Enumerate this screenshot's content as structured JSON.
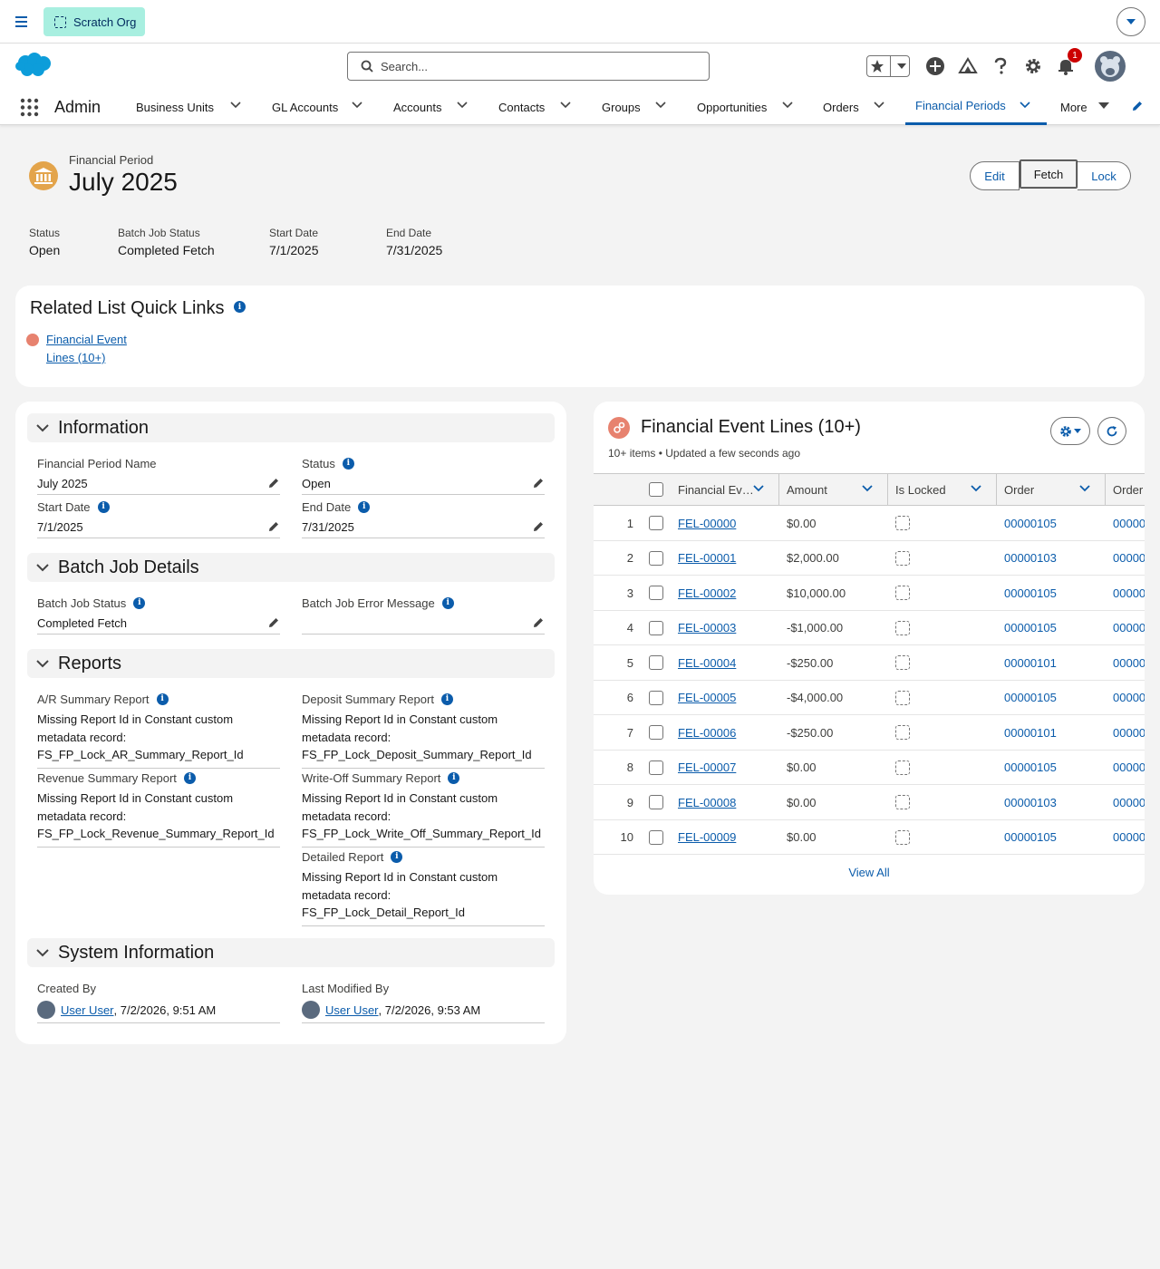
{
  "topbar": {
    "org_label": "Scratch Org"
  },
  "header": {
    "search_placeholder": "Search...",
    "notification_count": "1"
  },
  "nav": {
    "app_name": "Admin",
    "items": [
      {
        "label": "Business Units"
      },
      {
        "label": "GL Accounts"
      },
      {
        "label": "Accounts"
      },
      {
        "label": "Contacts"
      },
      {
        "label": "Groups"
      },
      {
        "label": "Opportunities"
      },
      {
        "label": "Orders"
      },
      {
        "label": "Financial Periods",
        "active": true
      },
      {
        "label": "More"
      }
    ]
  },
  "record": {
    "type": "Financial Period",
    "title": "July 2025",
    "buttons": {
      "edit": "Edit",
      "fetch": "Fetch",
      "lock": "Lock"
    },
    "highlights": [
      {
        "label": "Status",
        "value": "Open"
      },
      {
        "label": "Batch Job Status",
        "value": "Completed Fetch"
      },
      {
        "label": "Start Date",
        "value": "7/1/2025"
      },
      {
        "label": "End Date",
        "value": "7/31/2025"
      }
    ]
  },
  "quick_links": {
    "title": "Related List Quick Links",
    "link": "Financial Event Lines (10+)"
  },
  "detail": {
    "sections": {
      "information": "Information",
      "batch": "Batch Job Details",
      "reports": "Reports",
      "system": "System Information"
    },
    "info_fields": {
      "name_label": "Financial Period Name",
      "name_value": "July 2025",
      "status_label": "Status",
      "status_value": "Open",
      "start_label": "Start Date",
      "start_value": "7/1/2025",
      "end_label": "End Date",
      "end_value": "7/31/2025"
    },
    "batch_fields": {
      "status_label": "Batch Job Status",
      "status_value": "Completed Fetch",
      "error_label": "Batch Job Error Message",
      "error_value": ""
    },
    "report_fields": {
      "ar_label": "A/R Summary Report",
      "ar_value": "Missing Report Id in Constant custom metadata record: FS_FP_Lock_AR_Summary_Report_Id",
      "deposit_label": "Deposit Summary Report",
      "deposit_value": "Missing Report Id in Constant custom metadata record: FS_FP_Lock_Deposit_Summary_Report_Id",
      "revenue_label": "Revenue Summary Report",
      "revenue_value": "Missing Report Id in Constant custom metadata record: FS_FP_Lock_Revenue_Summary_Report_Id",
      "writeoff_label": "Write-Off Summary Report",
      "writeoff_value": "Missing Report Id in Constant custom metadata record: FS_FP_Lock_Write_Off_Summary_Report_Id",
      "detailed_label": "Detailed Report",
      "detailed_value": "Missing Report Id in Constant custom metadata record: FS_FP_Lock_Detail_Report_Id"
    },
    "system_fields": {
      "created_label": "Created By",
      "created_user": "User User",
      "created_date": ", 7/2/2026, 9:51 AM",
      "modified_label": "Last Modified By",
      "modified_user": "User User",
      "modified_date": ", 7/2/2026, 9:53 AM"
    }
  },
  "related_list": {
    "title": "Financial Event Lines (10+)",
    "meta": "10+ items • Updated a few seconds ago",
    "columns": [
      "Financial Ev…",
      "Amount",
      "Is Locked",
      "Order",
      "Order"
    ],
    "rows": [
      {
        "n": "1",
        "id": "FEL-00000",
        "amount": "$0.00",
        "order": "00000105",
        "order2": "00000"
      },
      {
        "n": "2",
        "id": "FEL-00001",
        "amount": "$2,000.00",
        "order": "00000103",
        "order2": "00000"
      },
      {
        "n": "3",
        "id": "FEL-00002",
        "amount": "$10,000.00",
        "order": "00000105",
        "order2": "00000"
      },
      {
        "n": "4",
        "id": "FEL-00003",
        "amount": "-$1,000.00",
        "order": "00000105",
        "order2": "00000"
      },
      {
        "n": "5",
        "id": "FEL-00004",
        "amount": "-$250.00",
        "order": "00000101",
        "order2": "00000"
      },
      {
        "n": "6",
        "id": "FEL-00005",
        "amount": "-$4,000.00",
        "order": "00000105",
        "order2": "00000"
      },
      {
        "n": "7",
        "id": "FEL-00006",
        "amount": "-$250.00",
        "order": "00000101",
        "order2": "00000"
      },
      {
        "n": "8",
        "id": "FEL-00007",
        "amount": "$0.00",
        "order": "00000105",
        "order2": "00000"
      },
      {
        "n": "9",
        "id": "FEL-00008",
        "amount": "$0.00",
        "order": "00000103",
        "order2": "00000"
      },
      {
        "n": "10",
        "id": "FEL-00009",
        "amount": "$0.00",
        "order": "00000105",
        "order2": "00000"
      }
    ],
    "view_all": "View All"
  },
  "icons": {
    "menu": "hamburger-icon",
    "scratch": "dashed-square-icon",
    "favorites": "star-icon",
    "add": "plus-circle-icon",
    "trailhead": "trailhead-icon",
    "help": "question-icon",
    "setup": "gear-icon",
    "notifications": "bell-icon",
    "period": "bank-icon",
    "edit": "pencil-icon",
    "info": "info-icon"
  },
  "colors": {
    "brand": "#0b5cab",
    "scratch_bg": "#a8efe0",
    "period_icon": "#e3a44b",
    "event_icon": "#e7826f",
    "badge": "#cc0000"
  }
}
